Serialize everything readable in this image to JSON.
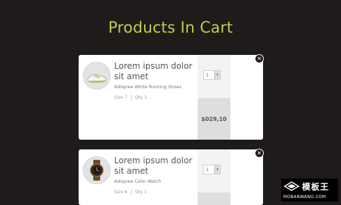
{
  "page": {
    "title": "Products In Cart"
  },
  "items": [
    {
      "name": "Lorem ipsum dolor sit amet",
      "description": "Adispree White Running Shoes",
      "size": "Size 7",
      "qty": "Qty 1",
      "selected_qty": "1",
      "price": "$029,10",
      "icon": "running-shoe-icon"
    },
    {
      "name": "Lorem ipsum dolor sit amet",
      "description": "Adispree Color Watch",
      "size": "Size 8",
      "qty": "Qty 1",
      "selected_qty": "1",
      "icon": "watch-icon"
    }
  ],
  "watermark": {
    "text": "模板王",
    "url": "MOBANWANG.COM"
  },
  "colors": {
    "background": "#1f1b1b",
    "accent": "#b9cf4e",
    "card": "#ffffff"
  }
}
